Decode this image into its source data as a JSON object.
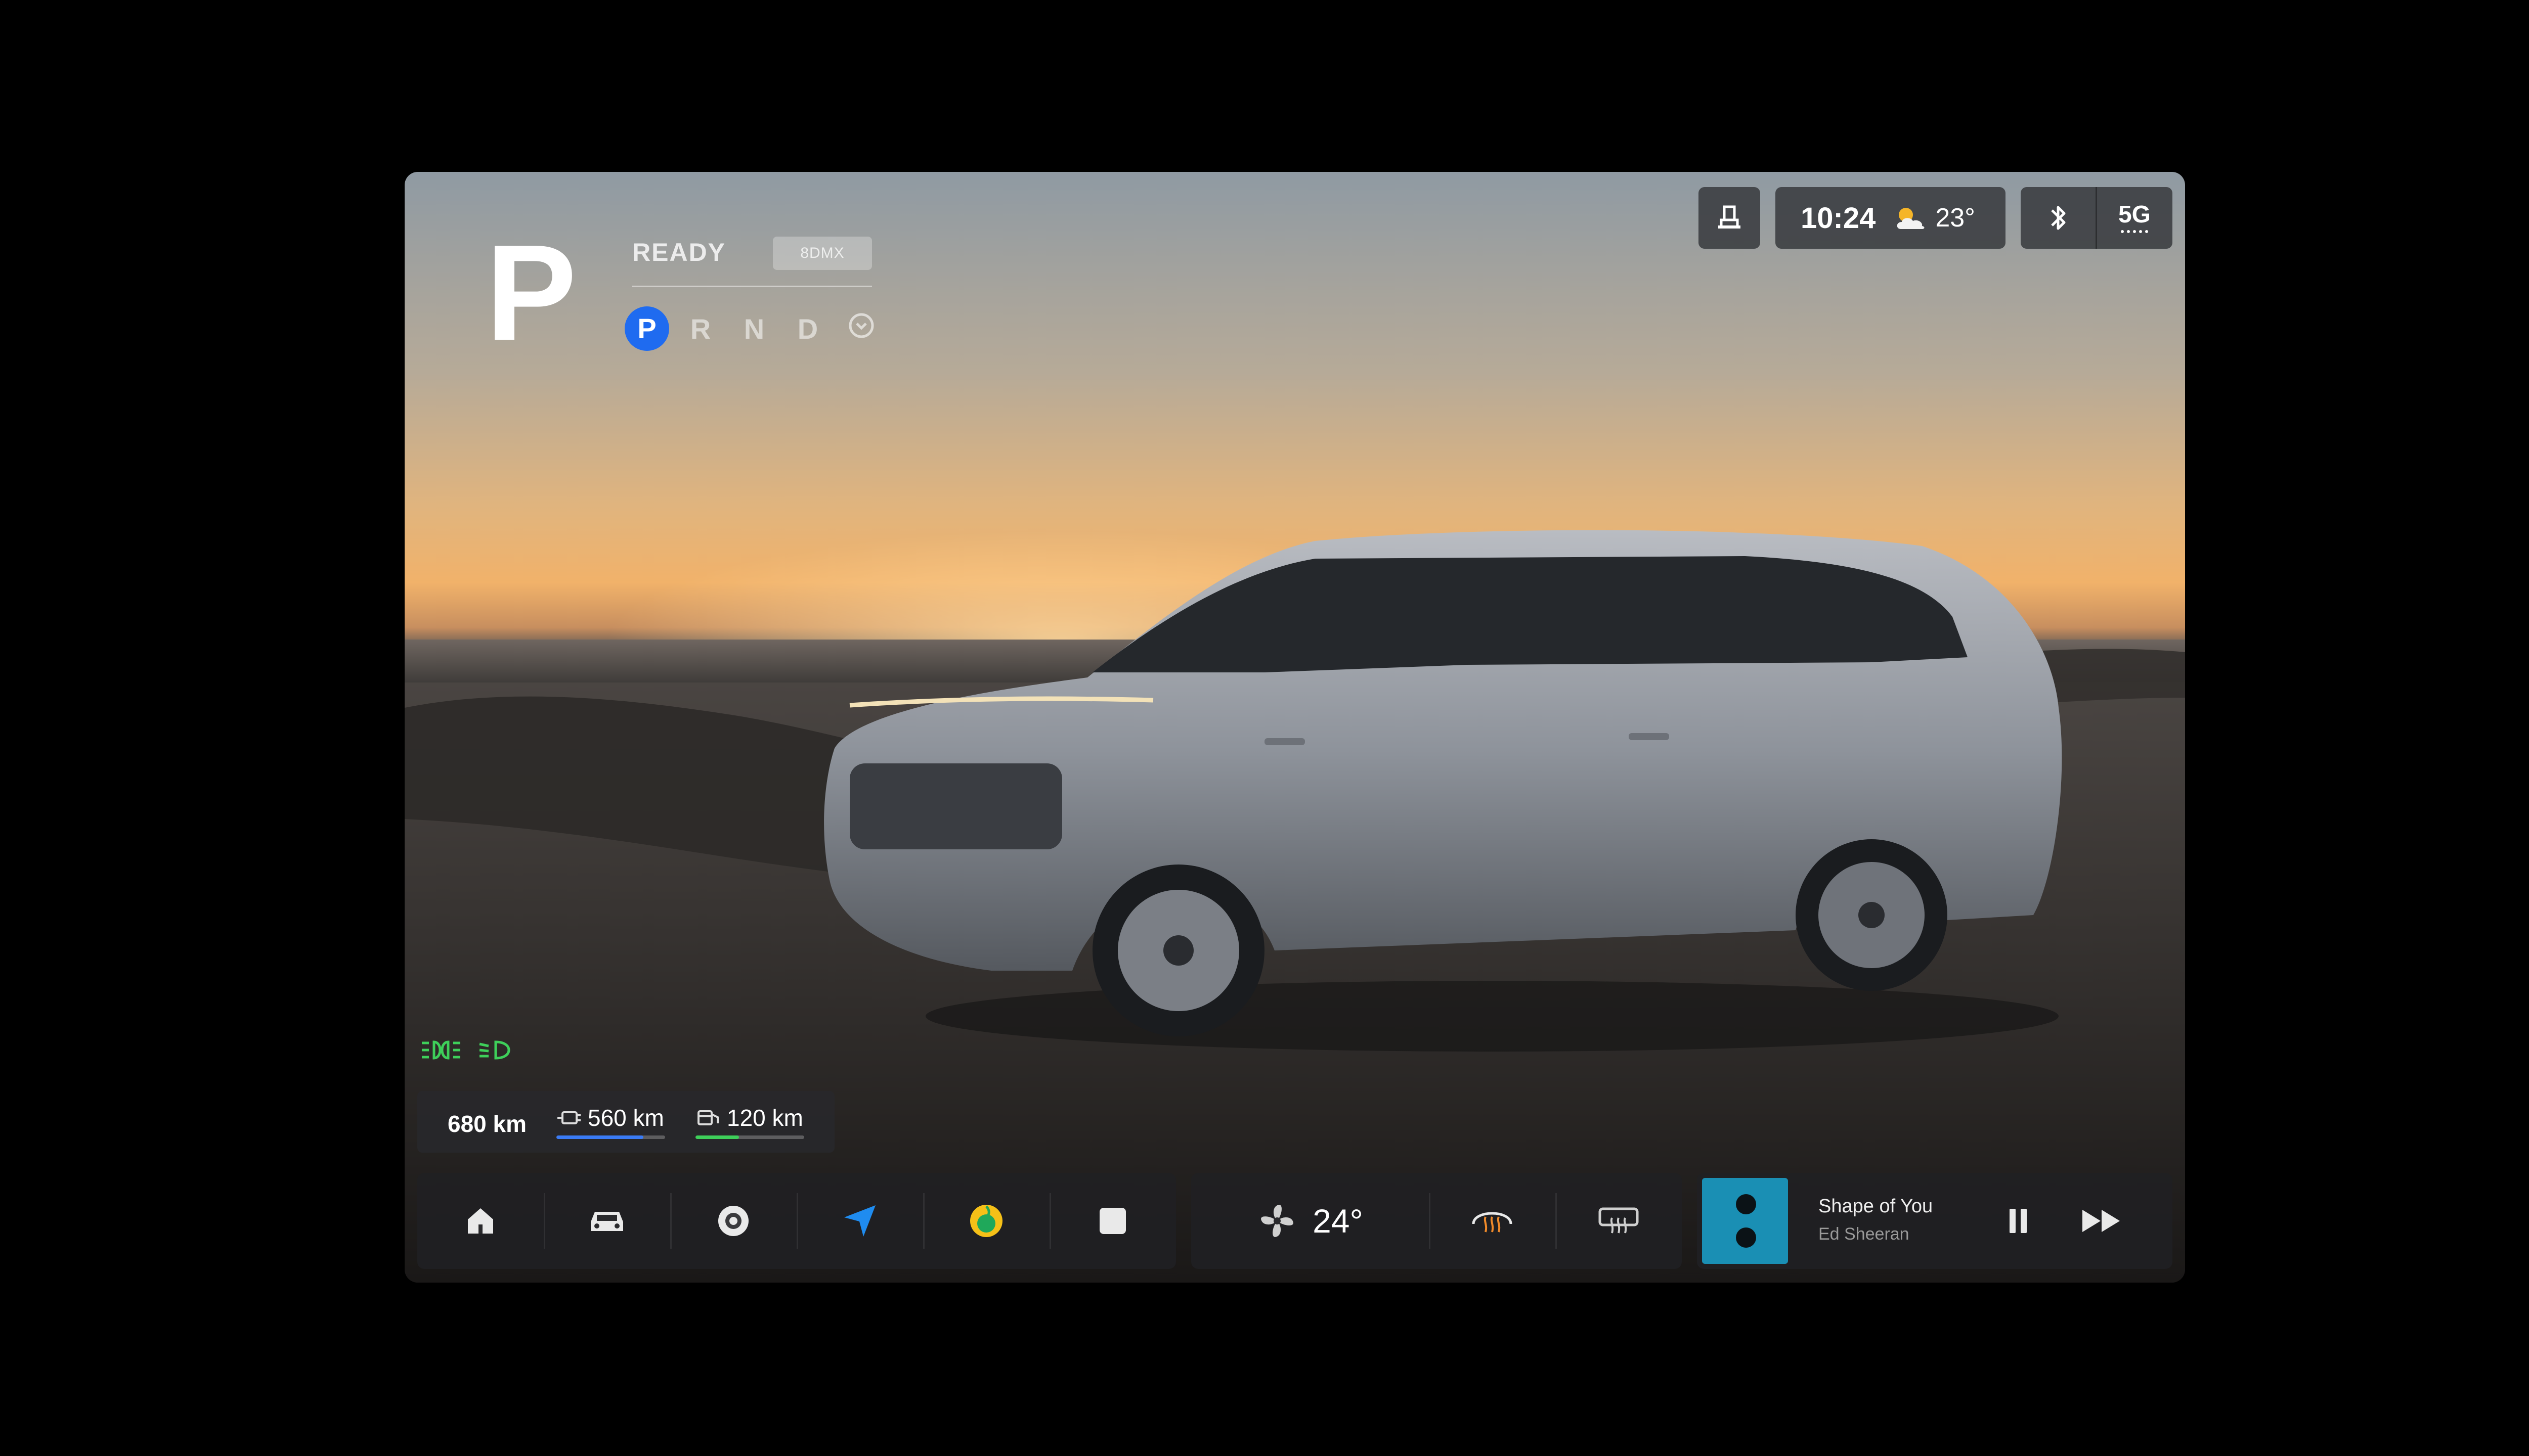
{
  "gear": {
    "current": "P",
    "status": "READY",
    "mode": "8DMX",
    "options": [
      "P",
      "R",
      "N",
      "D"
    ]
  },
  "status_bar": {
    "time": "10:24",
    "temperature": "23°",
    "network": "5G"
  },
  "range": {
    "total": "680 km",
    "electric": "560 km",
    "fuel": "120 km",
    "electric_fill": 0.8,
    "fuel_fill": 0.4
  },
  "climate": {
    "temperature": "24°"
  },
  "media": {
    "title": "Shape of You",
    "artist": "Ed Sheeran"
  },
  "colors": {
    "accent_blue": "#1f6bf0",
    "light_green": "#3ecf5a",
    "electric_bar": "#3a7bf6",
    "fuel_bar": "#3ecf5a",
    "album_art": "#1a8fb4"
  },
  "icons": {
    "status_left": "person-seat-icon",
    "weather": "partly-cloudy-icon",
    "bluetooth": "bluetooth-icon",
    "dock": [
      "home-icon",
      "car-icon",
      "camera-icon",
      "navigation-icon",
      "music-app-icon",
      "apps-icon"
    ],
    "climate": [
      "fan-icon",
      "front-defrost-icon",
      "rear-defrost-icon"
    ],
    "media": [
      "pause-icon",
      "fast-forward-icon"
    ]
  }
}
